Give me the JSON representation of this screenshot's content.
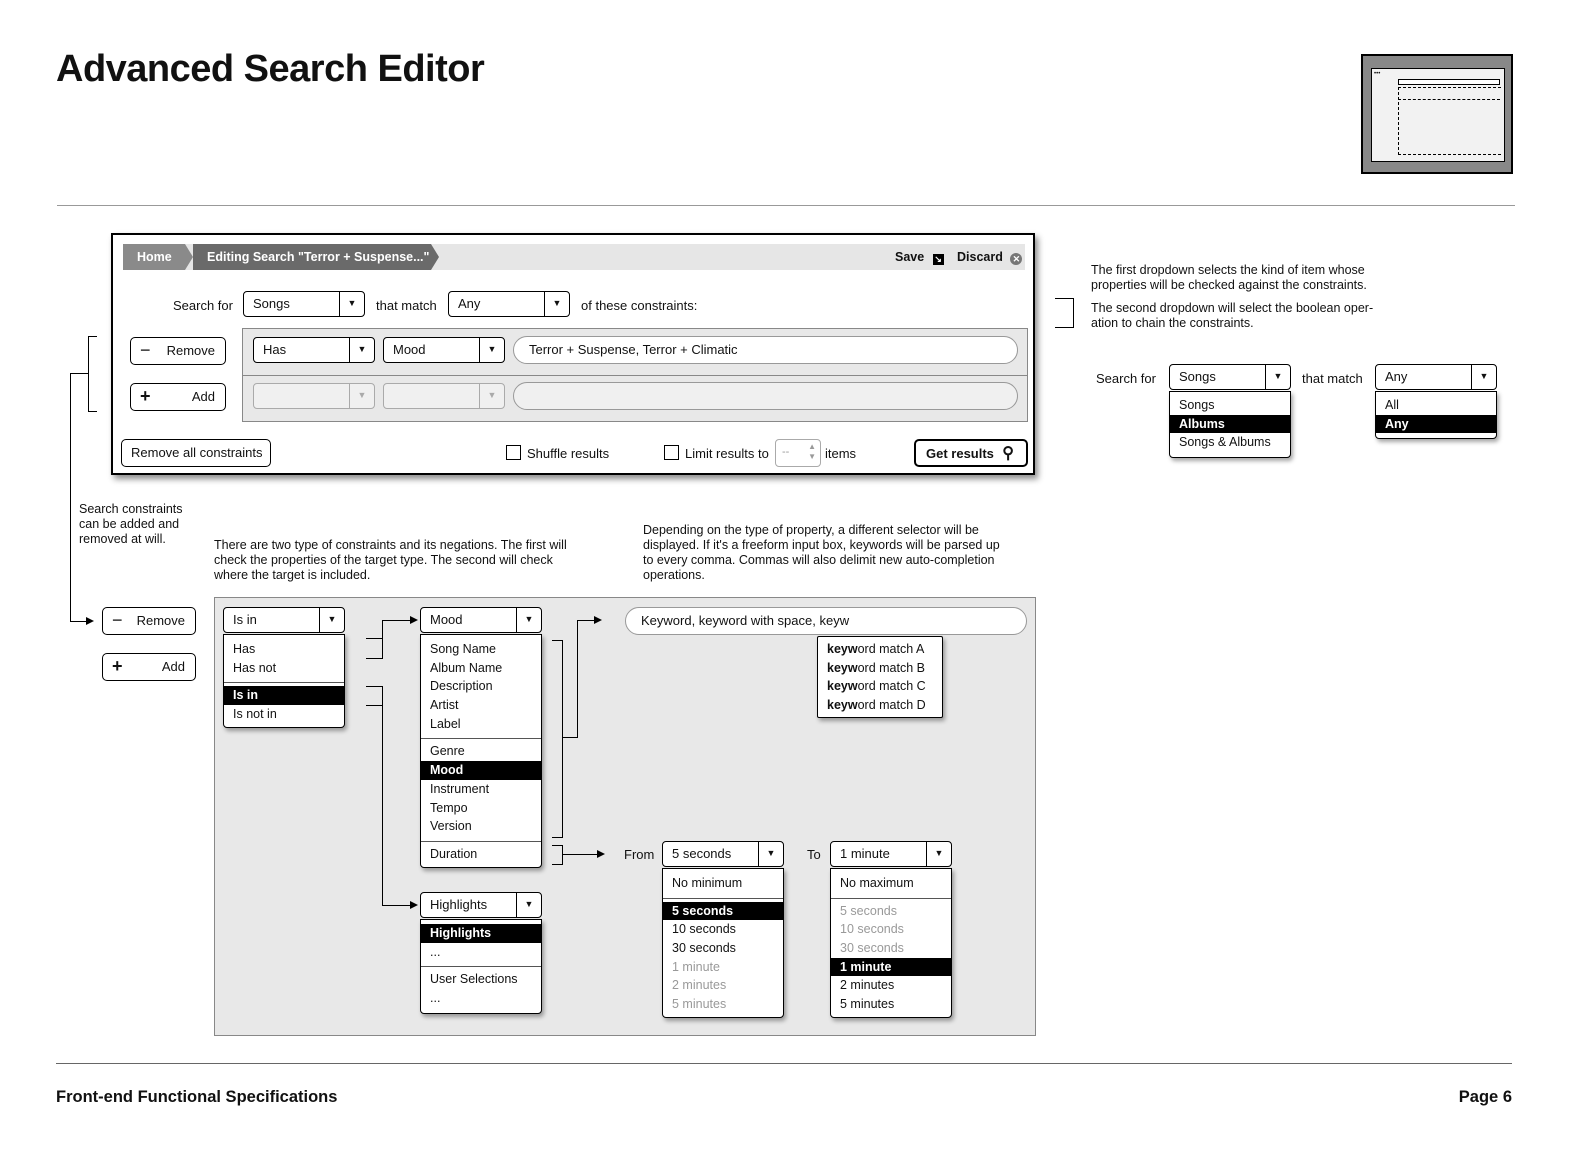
{
  "page": {
    "title": "Advanced Search Editor",
    "footer_left": "Front-end Functional Specifications",
    "footer_right": "Page 6"
  },
  "window": {
    "breadcrumb": {
      "home": "Home",
      "current": "Editing Search \"Terror + Suspense...\""
    },
    "save_label": "Save",
    "discard_label": "Discard",
    "search_for_label": "Search for",
    "search_for_value": "Songs",
    "that_match_label": "that match",
    "that_match_value": "Any",
    "of_these_label": "of these constraints:",
    "row1": {
      "type": "Has",
      "property": "Mood",
      "value": "Terror + Suspense, Terror + Climatic"
    },
    "remove_label": "Remove",
    "add_label": "Add",
    "remove_all_label": "Remove all constraints",
    "shuffle_label": "Shuffle results",
    "limit_label": "Limit results to",
    "limit_value": "--",
    "items_label": "items",
    "get_results_label": "Get results"
  },
  "notes": {
    "right_1": "The first dropdown selects the kind of item whose properties will be checked against the constraints.",
    "right_2": "The second dropdown will select the boolean oper-ation to chain the constraints.",
    "left": "Search constraints can be added and removed at will.",
    "mid": "There are two type of constraints and its negations. The first will check the properties of the target type. The second will check where the target is included.",
    "right_mid": "Depending on the type of property, a different selector will be displayed. If it's a freeform input box, keywords will be parsed up to every comma. Commas will also delimit new auto-completion operations."
  },
  "side_example": {
    "search_for_label": "Search for",
    "search_for_value": "Songs",
    "search_options": [
      "Songs",
      "Albums",
      "Songs & Albums"
    ],
    "that_match_label": "that match",
    "match_value": "Any",
    "match_options": [
      "All",
      "Any"
    ]
  },
  "detail": {
    "remove_label": "Remove",
    "add_label": "Add",
    "type_value": "Is in",
    "type_options_a": [
      "Has",
      "Has not"
    ],
    "type_options_b": [
      "Is in",
      "Is not in"
    ],
    "mood_value": "Mood",
    "mood_group1": [
      "Song Name",
      "Album Name",
      "Description",
      "Artist",
      "Label"
    ],
    "mood_group2": [
      "Genre",
      "Mood",
      "Instrument",
      "Tempo",
      "Version"
    ],
    "mood_group3": [
      "Duration"
    ],
    "highlights_value": "Highlights",
    "highlights_group1": [
      "Highlights",
      "..."
    ],
    "highlights_group2": [
      "User Selections",
      "..."
    ],
    "keyword_input": "Keyword, keyword with space, keyw",
    "keyword_matches": [
      {
        "bold": "keyw",
        "rest": "ord match A"
      },
      {
        "bold": "keyw",
        "rest": "ord match B"
      },
      {
        "bold": "keyw",
        "rest": "ord match C"
      },
      {
        "bold": "keyw",
        "rest": "ord match D"
      }
    ],
    "from_label": "From",
    "from_value": "5 seconds",
    "from_head": "No minimum",
    "from_options": [
      "5 seconds",
      "10 seconds",
      "30 seconds",
      "1 minute",
      "2 minutes",
      "5 minutes"
    ],
    "to_label": "To",
    "to_value": "1 minute",
    "to_head": "No maximum",
    "to_options": [
      "5 seconds",
      "10 seconds",
      "30 seconds",
      "1 minute",
      "2 minutes",
      "5 minutes"
    ]
  }
}
